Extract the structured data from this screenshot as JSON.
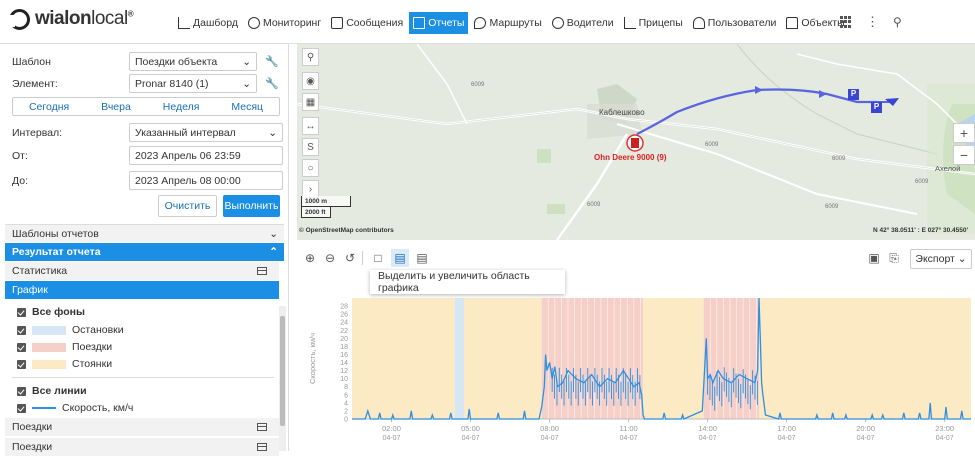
{
  "brand": {
    "name_bold": "wialon",
    "name_light": "local",
    "tm": "®"
  },
  "nav": [
    {
      "label": "Дашборд",
      "icon": "dashboard-icon"
    },
    {
      "label": "Мониторинг",
      "icon": "monitoring-icon"
    },
    {
      "label": "Сообщения",
      "icon": "messages-icon"
    },
    {
      "label": "Отчеты",
      "icon": "reports-icon",
      "active": true
    },
    {
      "label": "Маршруты",
      "icon": "routes-icon"
    },
    {
      "label": "Водители",
      "icon": "drivers-icon"
    },
    {
      "label": "Прицепы",
      "icon": "trailers-icon"
    },
    {
      "label": "Пользователи",
      "icon": "users-icon"
    },
    {
      "label": "Объекты",
      "icon": "objects-icon"
    }
  ],
  "form": {
    "template_label": "Шаблон",
    "template_value": "Поездки объекта",
    "element_label": "Элемент:",
    "element_value": "Pronar 8140 (1)",
    "quick": [
      "Сегодня",
      "Вчера",
      "Неделя",
      "Месяц"
    ],
    "interval_label": "Интервал:",
    "interval_value": "Указанный интервал",
    "from_label": "От:",
    "from_value": "2023 Апрель 06 23:59",
    "to_label": "До:",
    "to_value": "2023 Апрель 08 00:00",
    "clear": "Очистить",
    "run": "Выполнить"
  },
  "sections": {
    "templates": "Шаблоны отчетов",
    "result": "Результат отчета",
    "stats": "Статистика",
    "graph": "График",
    "trips1": "Поездки",
    "trips2": "Поездки"
  },
  "legend": {
    "all_bg": "Все фоны",
    "stops": "Остановки",
    "stops_color": "#d6e6f5",
    "trips": "Поездки",
    "trips_color": "#f6d0c8",
    "parkings": "Стоянки",
    "parkings_color": "#fbeac4",
    "all_lines": "Все линии",
    "speed": "Скорость, км/ч",
    "speed_color": "#2f8fe0"
  },
  "map": {
    "village": "Каблешково",
    "unit": "Ohn Deere 9000 (9)",
    "road_labels": [
      "6009",
      "6009",
      "6009",
      "6009",
      "6009",
      "6009"
    ],
    "town": "Ахелой",
    "scale_m": "1000 m",
    "scale_ft": "2000 ft",
    "attribution": "© OpenStreetMap contributors",
    "coords": "N 42° 38.0511' : E 027° 30.4550'"
  },
  "chart_toolbar": {
    "tooltip": "Выделить и увеличить область графика",
    "export": "Экспорт"
  },
  "chart_data": {
    "type": "line",
    "ylabel": "Скорость, км/ч",
    "yticks": [
      0,
      2,
      4,
      6,
      8,
      10,
      12,
      14,
      16,
      18,
      20,
      22,
      24,
      26,
      28
    ],
    "ylim": [
      0,
      30
    ],
    "xlim": [
      0.5,
      24.0
    ],
    "xticks": [
      {
        "t": 2,
        "label": "02:00",
        "sub": "04-07"
      },
      {
        "t": 5,
        "label": "05:00",
        "sub": "04-07"
      },
      {
        "t": 8,
        "label": "08:00",
        "sub": "04-07"
      },
      {
        "t": 11,
        "label": "11:00",
        "sub": "04-07"
      },
      {
        "t": 14,
        "label": "14:00",
        "sub": "04-07"
      },
      {
        "t": 17,
        "label": "17:00",
        "sub": "04-07"
      },
      {
        "t": 20,
        "label": "20:00",
        "sub": "04-07"
      },
      {
        "t": 23,
        "label": "23:00",
        "sub": "04-07"
      }
    ],
    "background": [
      {
        "from": 0.5,
        "to": 4.4,
        "kind": "parking"
      },
      {
        "from": 4.4,
        "to": 4.75,
        "kind": "stop"
      },
      {
        "from": 4.75,
        "to": 7.7,
        "kind": "parking"
      },
      {
        "from": 7.7,
        "to": 11.55,
        "kind": "trip"
      },
      {
        "from": 11.55,
        "to": 13.85,
        "kind": "parking"
      },
      {
        "from": 13.85,
        "to": 15.95,
        "kind": "trip"
      },
      {
        "from": 15.95,
        "to": 24.0,
        "kind": "parking"
      }
    ],
    "series": [
      {
        "name": "Скорость, км/ч",
        "x": [
          0.5,
          1.0,
          1.1,
          1.15,
          1.2,
          1.5,
          1.55,
          1.6,
          2.0,
          2.05,
          2.1,
          2.7,
          2.75,
          2.8,
          3.5,
          3.55,
          3.6,
          4.2,
          4.25,
          4.3,
          4.4,
          4.9,
          4.95,
          5.0,
          6.0,
          6.05,
          6.1,
          7.0,
          7.05,
          7.1,
          7.6,
          7.7,
          7.8,
          7.85,
          7.9,
          8.0,
          8.1,
          8.2,
          8.3,
          8.5,
          8.7,
          9.0,
          9.3,
          9.6,
          9.9,
          10.2,
          10.5,
          10.8,
          11.0,
          11.2,
          11.4,
          11.5,
          11.55,
          11.6,
          12.3,
          12.35,
          12.4,
          13.0,
          13.05,
          13.1,
          13.8,
          13.9,
          13.95,
          14.0,
          14.1,
          14.2,
          14.4,
          14.6,
          14.9,
          15.2,
          15.5,
          15.8,
          15.9,
          15.95,
          16.0,
          16.05,
          16.1,
          16.2,
          16.7,
          16.75,
          16.8,
          18.1,
          18.15,
          18.2,
          18.7,
          18.75,
          18.8,
          19.2,
          19.25,
          19.3,
          20.2,
          20.25,
          20.3,
          20.6,
          20.65,
          20.7,
          21.4,
          21.45,
          21.5,
          22.0,
          22.05,
          22.1,
          22.4,
          22.45,
          22.5,
          23.0,
          23.05,
          23.1,
          23.6,
          23.65,
          23.7,
          24.0
        ],
        "y": [
          0,
          0,
          2,
          1,
          0,
          0,
          1.5,
          0,
          0,
          1,
          0,
          0,
          2,
          0,
          0,
          1,
          0,
          0,
          1.5,
          0,
          0,
          0,
          2.5,
          0,
          0,
          1.5,
          0,
          0,
          2,
          0,
          0,
          3,
          8,
          16,
          12,
          14,
          10,
          13,
          8,
          9,
          12,
          10,
          9,
          11,
          8,
          10,
          9,
          12,
          10,
          8,
          9,
          6,
          1,
          0,
          0,
          1.5,
          0,
          0,
          1,
          0,
          2,
          14,
          20,
          10,
          11,
          9,
          12,
          10,
          9,
          11,
          10,
          9,
          12,
          30,
          20,
          9,
          6,
          1,
          0,
          1.5,
          0,
          0,
          1,
          0,
          0,
          1.5,
          0,
          0,
          1,
          0,
          0,
          1,
          0,
          0,
          1,
          0,
          0,
          1.5,
          0,
          0,
          1.5,
          0,
          0,
          4,
          0,
          0,
          3,
          0,
          0,
          2,
          0,
          0
        ]
      }
    ]
  }
}
